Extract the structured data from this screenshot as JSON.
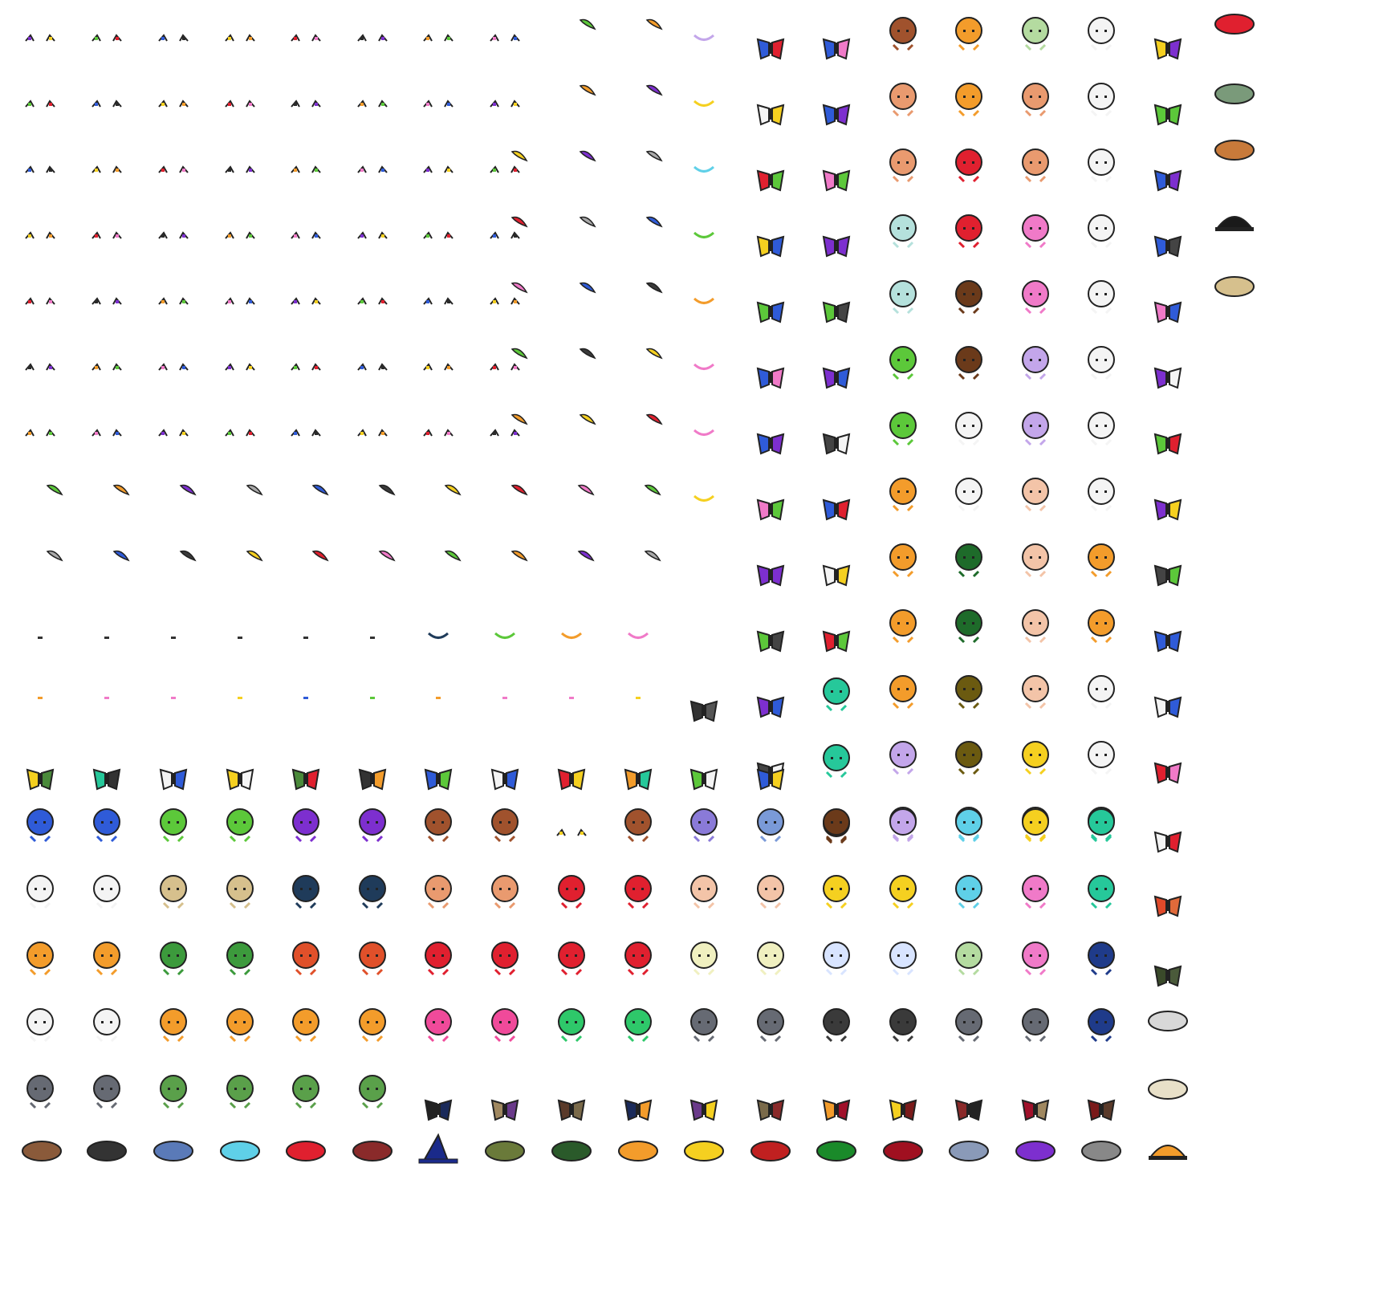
{
  "sheet": {
    "background": "#ffffff",
    "description_kind": "pixel-art sprite atlas (character heads, eyes, mouths, wings, hats)",
    "palette": {
      "brown": "#a0522d",
      "darkbrown": "#6b3a1a",
      "orange": "#f39c2b",
      "lightgreen": "#b4dba0",
      "white": "#f4f4f4",
      "blue": "#2f5bd8",
      "green": "#5cc83a",
      "purple": "#7d2fcf",
      "navy": "#1f3b5a",
      "salmon": "#e99a6f",
      "red": "#e0202f",
      "peach": "#f3c4a8",
      "yellow": "#f5d020",
      "cyan": "#5fd0e8",
      "pink": "#f07ac8",
      "teal": "#26c89a",
      "gray": "#666a73",
      "black": "#1a1a1a",
      "lavender": "#c3a6ea",
      "mint": "#b5e1dc",
      "tan": "#d6c08d"
    }
  }
}
